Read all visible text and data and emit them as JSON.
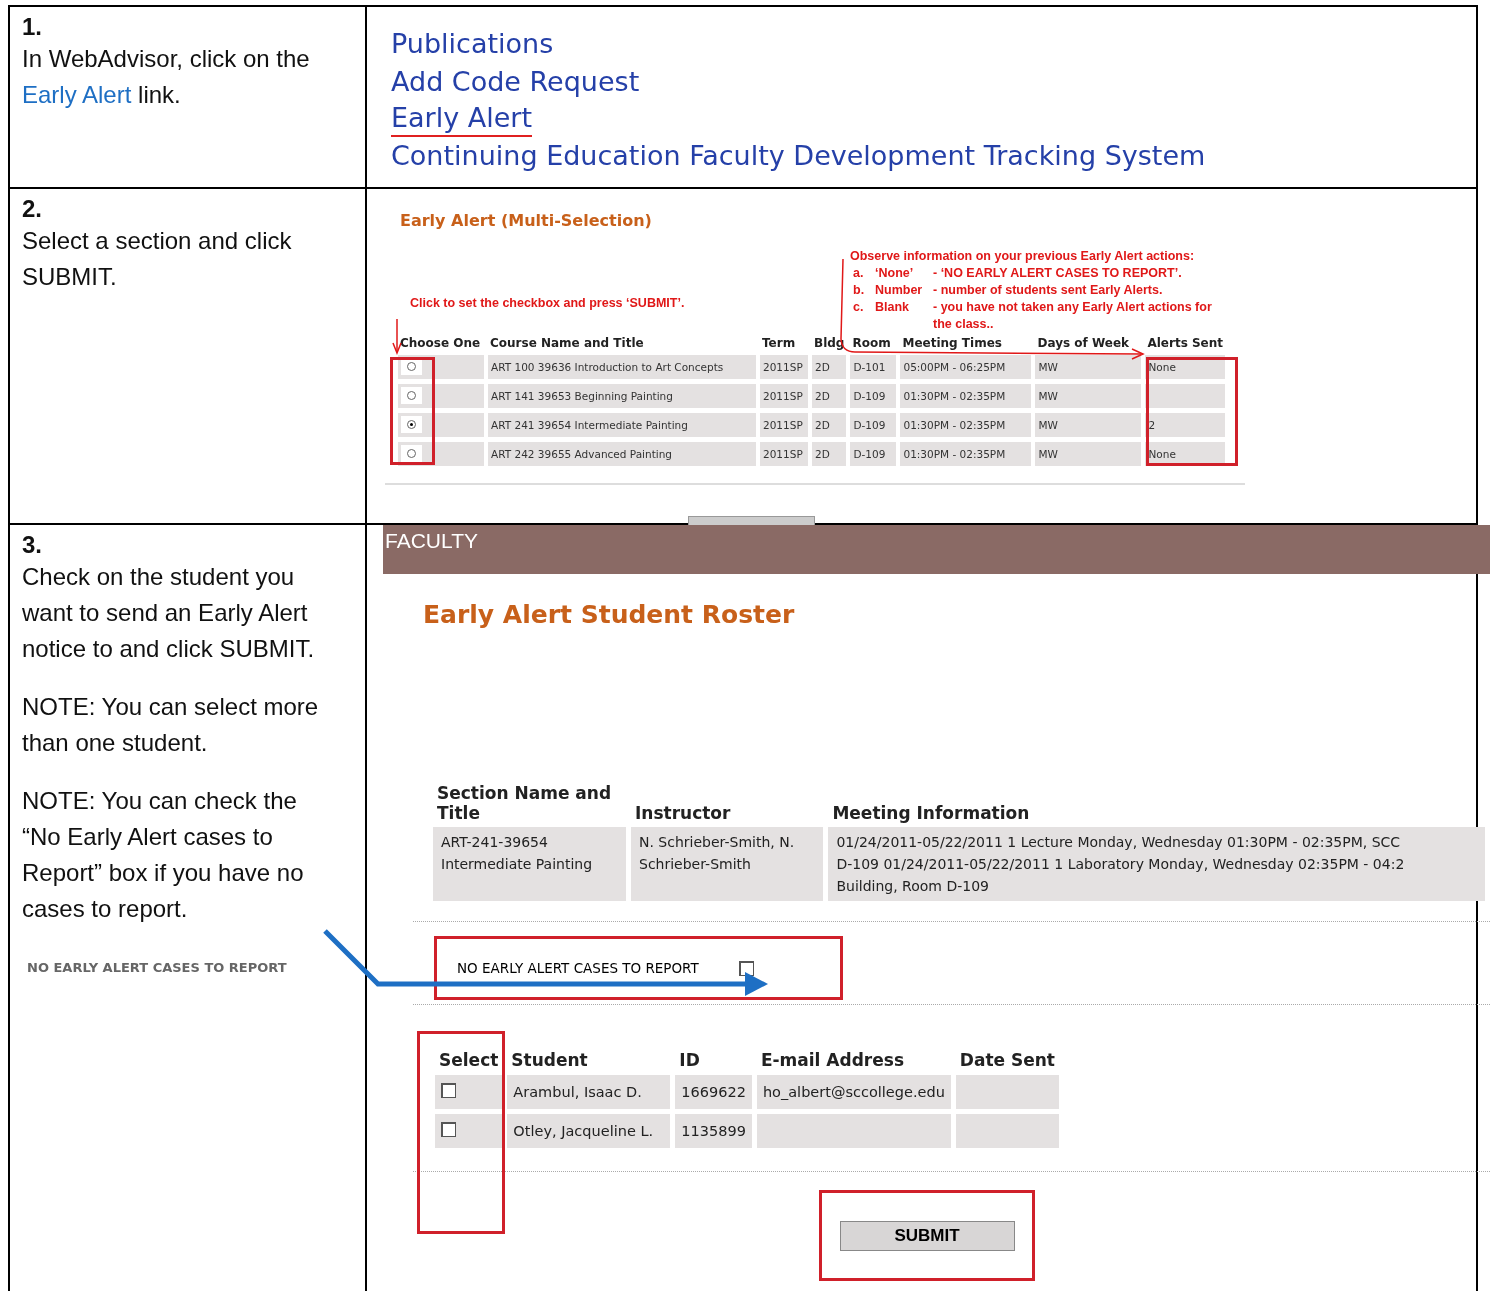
{
  "steps": [
    {
      "number": "1.",
      "paragraphs": [
        {
          "before": "In WebAdvisor, click on the ",
          "link": "Early Alert",
          "after": " link."
        }
      ]
    },
    {
      "number": "2.",
      "paragraphs": [
        {
          "before": "Select a section and click SUBMIT."
        }
      ]
    },
    {
      "number": "3.",
      "paragraphs": [
        {
          "before": "Check on the student you want to send an Early Alert notice to and click SUBMIT."
        },
        {
          "before": "NOTE: You can select more than one student."
        },
        {
          "before": "NOTE: You can check the “No Early Alert cases to Report” box if you have no cases to report."
        }
      ],
      "inset_label": "NO EARLY ALERT CASES TO REPORT"
    }
  ],
  "menu": {
    "items": [
      {
        "label": "Publications",
        "highlighted": false
      },
      {
        "label": "Add Code Request",
        "highlighted": false
      },
      {
        "label": "Early Alert",
        "highlighted": true
      },
      {
        "label": "Continuing Education Faculty Development Tracking System",
        "highlighted": false
      }
    ]
  },
  "multi_selection": {
    "title": "Early Alert (Multi-Selection)",
    "hint": "Click to set the checkbox and press ‘SUBMIT’.",
    "note_heading": "Observe information on your previous Early Alert actions:",
    "note_items": [
      {
        "letter": "a.",
        "term": "‘None’",
        "desc": "- ‘NO EARLY ALERT CASES TO REPORT’."
      },
      {
        "letter": "b.",
        "term": "Number",
        "desc": "- number of students sent Early Alerts."
      },
      {
        "letter": "c.",
        "term": "Blank",
        "desc": "- you have not taken any Early Alert actions for the class.."
      }
    ],
    "columns": [
      "Choose One",
      "Course Name and Title",
      "Term",
      "Bldg",
      "Room",
      "Meeting Times",
      "Days of Week",
      "Alerts Sent"
    ],
    "rows": [
      {
        "selected": false,
        "cells": [
          "",
          "ART 100 39636 Introduction to Art Concepts",
          "2011SP",
          "2D",
          "D-101",
          "05:00PM - 06:25PM",
          "MW",
          "None"
        ]
      },
      {
        "selected": false,
        "cells": [
          "",
          "ART 141 39653 Beginning Painting",
          "2011SP",
          "2D",
          "D-109",
          "01:30PM - 02:35PM",
          "MW",
          ""
        ]
      },
      {
        "selected": true,
        "cells": [
          "",
          "ART 241 39654 Intermediate Painting",
          "2011SP",
          "2D",
          "D-109",
          "01:30PM - 02:35PM",
          "MW",
          "2"
        ]
      },
      {
        "selected": false,
        "cells": [
          "",
          "ART 242 39655 Advanced Painting",
          "2011SP",
          "2D",
          "D-109",
          "01:30PM - 02:35PM",
          "MW",
          "None"
        ]
      }
    ]
  },
  "roster": {
    "header": "FACULTY",
    "title": "Early Alert Student Roster",
    "section_columns": [
      "Section Name and Title",
      "Instructor",
      "Meeting Information"
    ],
    "section_row": [
      [
        "ART-241-39654",
        "Intermediate Painting"
      ],
      [
        "N. Schrieber-Smith, N.",
        "Schrieber-Smith"
      ],
      [
        "01/24/2011-05/22/2011 1 Lecture Monday, Wednesday 01:30PM - 02:35PM, SCC",
        "D-109 01/24/2011-05/22/2011 1 Laboratory Monday, Wednesday 02:35PM - 04:2",
        "Building, Room D-109"
      ]
    ],
    "no_cases": {
      "label": "NO EARLY ALERT CASES TO REPORT",
      "checked": false
    },
    "student_columns": [
      "Select",
      "Student",
      "ID",
      "E-mail Address",
      "Date Sent"
    ],
    "students": [
      {
        "checked": false,
        "cells": [
          "Arambul, Isaac D.",
          "1669622",
          "ho_albert@sccollege.edu",
          ""
        ]
      },
      {
        "checked": false,
        "cells": [
          "Otley, Jacqueline L.",
          "1135899",
          "",
          ""
        ]
      }
    ],
    "submit": "SUBMIT"
  }
}
